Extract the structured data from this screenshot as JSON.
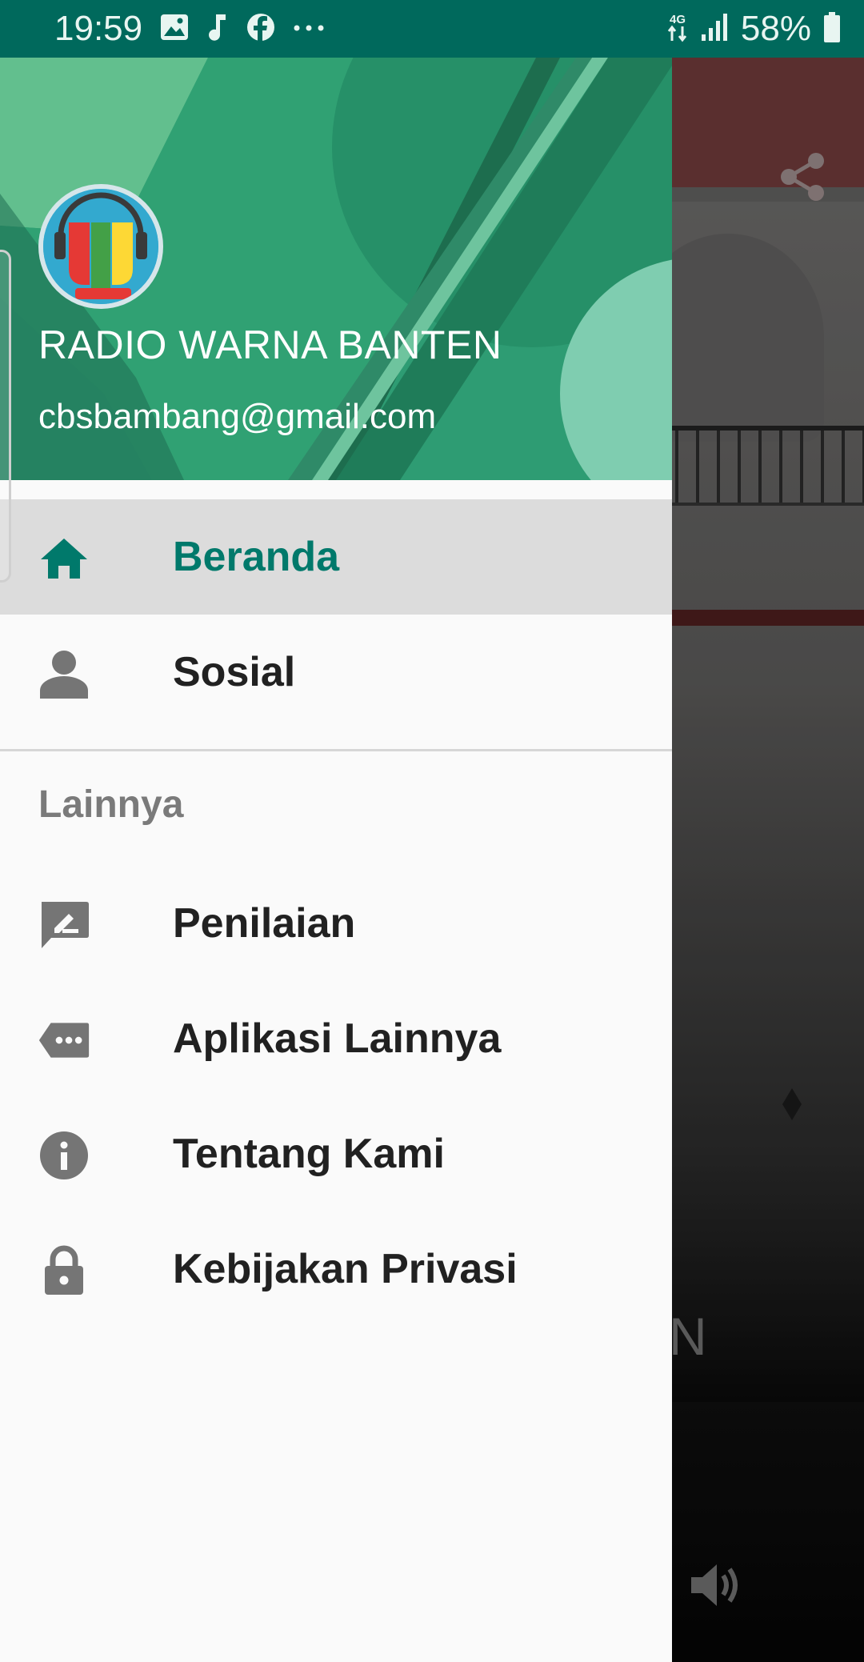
{
  "status_bar": {
    "time": "19:59",
    "network": "4G",
    "battery_percent": "58%",
    "notification_icons": [
      "image-icon",
      "music-note-icon",
      "facebook-icon",
      "more-dots-icon"
    ],
    "background_color": "#00695c"
  },
  "drawer": {
    "header": {
      "station_name": "RADIO WARNA BANTEN",
      "email": "cbsbambang@gmail.com",
      "background_color": "#2e9c73"
    },
    "primary_items": [
      {
        "label": "Beranda",
        "icon": "home-icon",
        "selected": true
      },
      {
        "label": "Sosial",
        "icon": "person-icon",
        "selected": false
      }
    ],
    "section_title": "Lainnya",
    "secondary_items": [
      {
        "label": "Penilaian",
        "icon": "rate-review-icon"
      },
      {
        "label": "Aplikasi Lainnya",
        "icon": "more-apps-icon"
      },
      {
        "label": "Tentang Kami",
        "icon": "info-icon"
      },
      {
        "label": "Kebijakan Privasi",
        "icon": "lock-icon"
      }
    ],
    "accent_color": "#00796b"
  },
  "background_app": {
    "partial_title_letter": "N"
  }
}
